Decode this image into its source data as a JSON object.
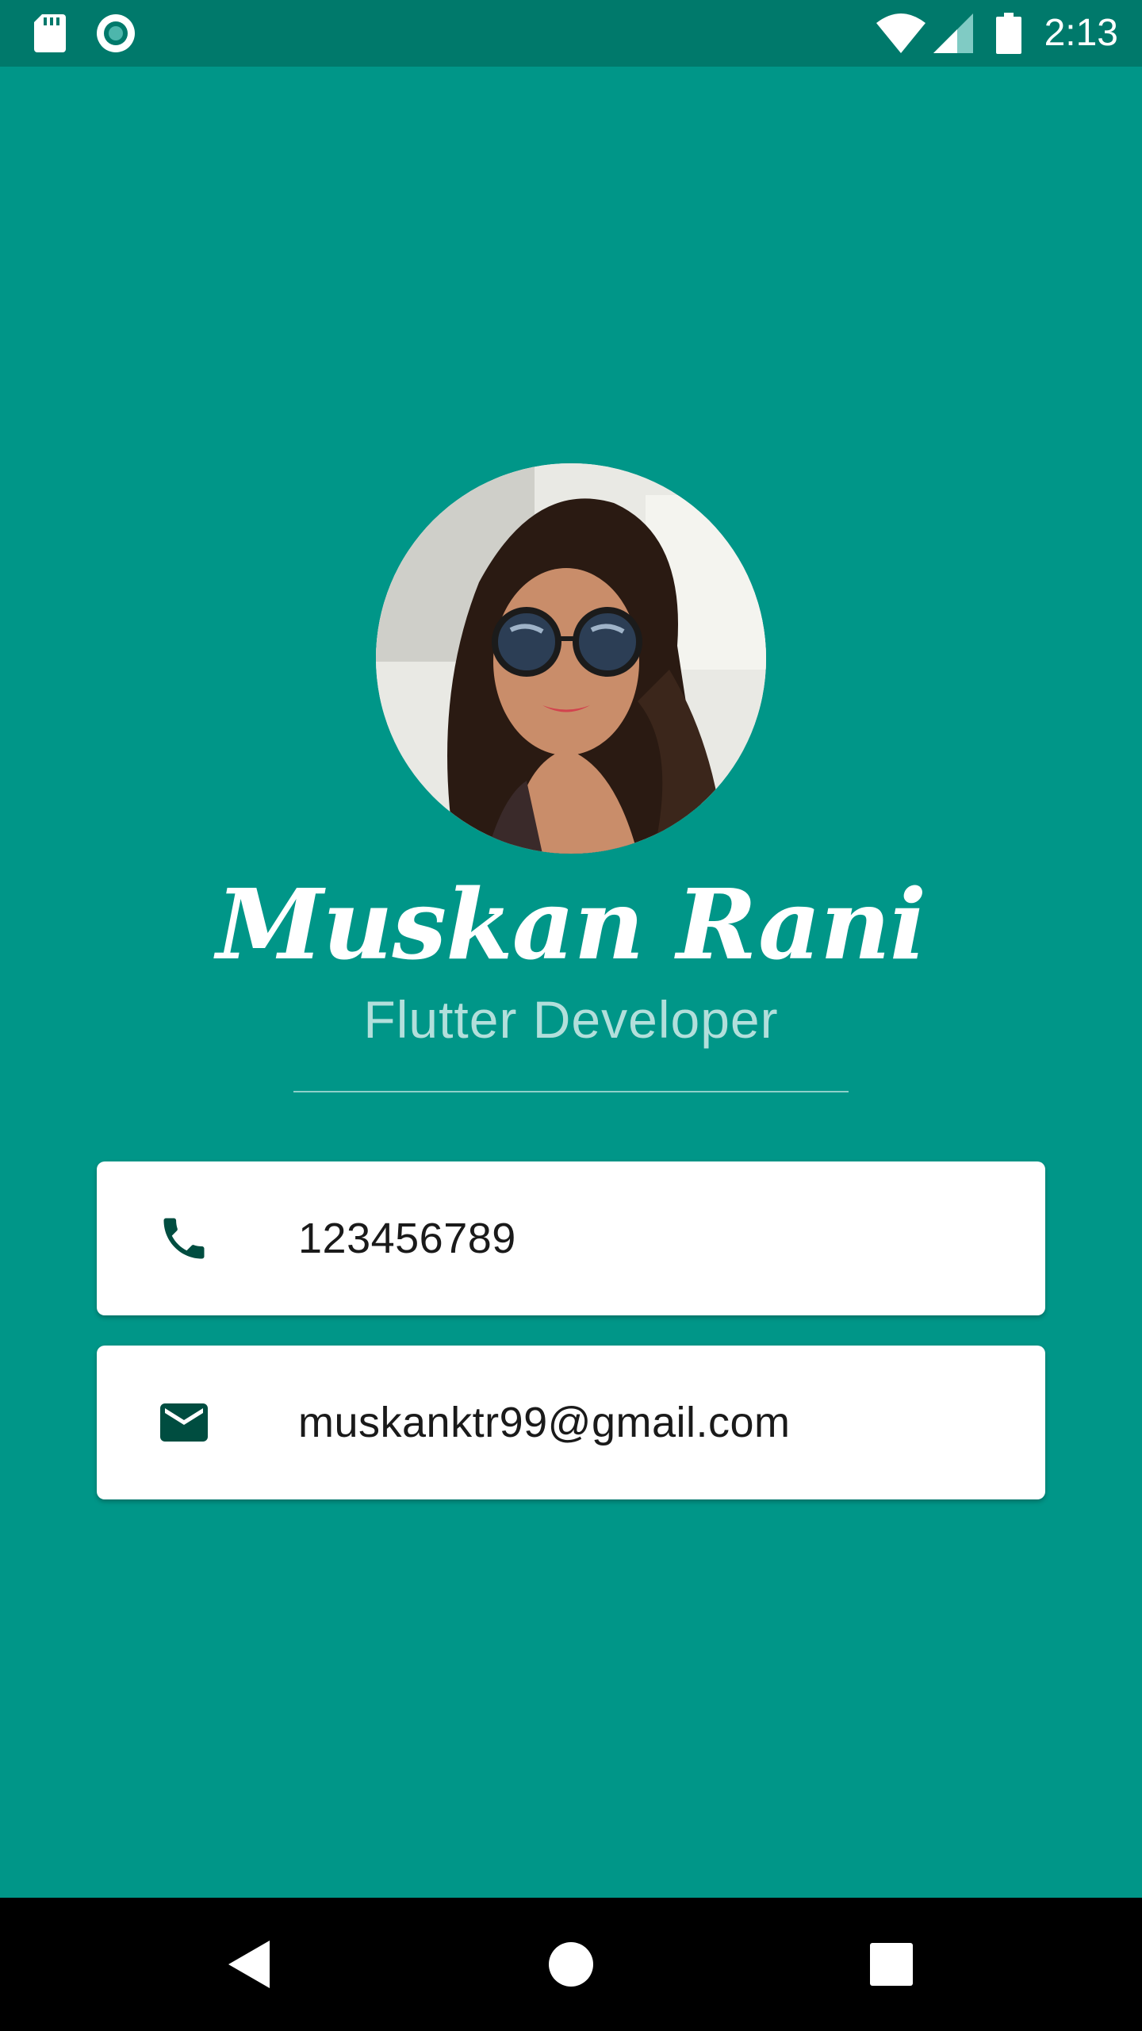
{
  "status_bar": {
    "time": "2:13",
    "left_icons": [
      "sd-card-icon",
      "sync-circle-icon"
    ],
    "right_icons": [
      "wifi-icon",
      "cell-signal-icon",
      "battery-icon"
    ]
  },
  "profile": {
    "avatar_alt": "profile-photo",
    "name": "Muskan Rani",
    "title": "Flutter Developer"
  },
  "contacts": [
    {
      "icon": "phone-icon",
      "value": "123456789"
    },
    {
      "icon": "email-icon",
      "value": "muskanktr99@gmail.com"
    }
  ],
  "nav_bar": {
    "buttons": [
      "back-icon",
      "home-icon",
      "recents-icon"
    ]
  },
  "colors": {
    "background": "#009688",
    "status_bar": "#00796b",
    "subtitle": "#b2dfdb",
    "icon_dark": "#004d40",
    "card": "#ffffff"
  }
}
